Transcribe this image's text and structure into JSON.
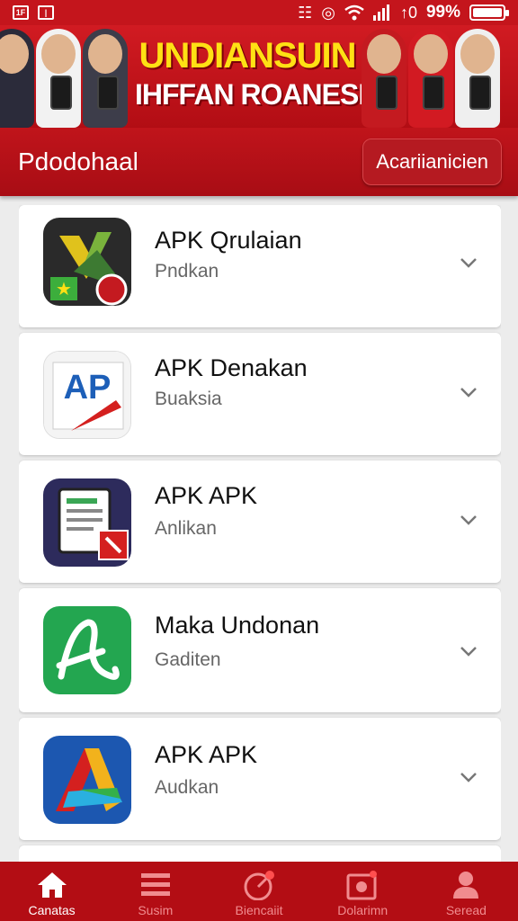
{
  "status_bar": {
    "left_icons": [
      "sim-icon",
      "notification-icon"
    ],
    "right_icons": [
      "vibrate-icon",
      "alarm-icon",
      "wifi-icon",
      "signal-icon",
      "data-icon"
    ],
    "battery_percent": "99%",
    "battery_level": 0.99
  },
  "banner": {
    "title": "UNDIANSUIN",
    "subtitle": "IHFFAN ROANESIA"
  },
  "appbar": {
    "title": "Pdodohaal",
    "button_label": "Acariianicien"
  },
  "apps": [
    {
      "title": "APK Qrulaian",
      "subtitle": "Pndkan",
      "icon": "app-icon-1"
    },
    {
      "title": "APK Denakan",
      "subtitle": "Buaksia",
      "icon": "app-icon-2"
    },
    {
      "title": "APK APK",
      "subtitle": "Anlikan",
      "icon": "app-icon-3"
    },
    {
      "title": "Maka Undonan",
      "subtitle": "Gaditen",
      "icon": "app-icon-4"
    },
    {
      "title": "APK APK",
      "subtitle": "Audkan",
      "icon": "app-icon-5"
    }
  ],
  "bottom_nav": [
    {
      "label": "Canatas",
      "icon": "home-icon",
      "active": true
    },
    {
      "label": "Susim",
      "icon": "list-icon",
      "active": false
    },
    {
      "label": "Biencaiit",
      "icon": "gauge-icon",
      "active": false
    },
    {
      "label": "Dolarimn",
      "icon": "photo-icon",
      "active": false
    },
    {
      "label": "Seread",
      "icon": "profile-icon",
      "active": false
    }
  ],
  "colors": {
    "primary": "#c4151c",
    "dark": "#a80d14",
    "accent": "#ffe014"
  }
}
